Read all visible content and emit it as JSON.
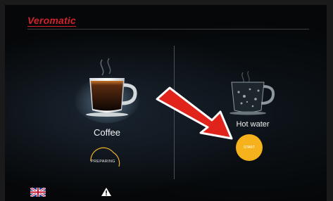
{
  "header": {
    "brand": "Veromatic"
  },
  "products": [
    {
      "name": "Coffee",
      "status": "PREPARING",
      "progress": 0.3
    },
    {
      "name": "Hot water",
      "action": "START"
    }
  ],
  "icons": {
    "language": "uk-flag-icon",
    "warning": "warning-icon",
    "pointer": "red-arrow-icon"
  },
  "colors": {
    "brand": "#d2232a",
    "start_button": "#f5b21c",
    "arrow": "#e0241b",
    "progress": "#f2b329"
  }
}
